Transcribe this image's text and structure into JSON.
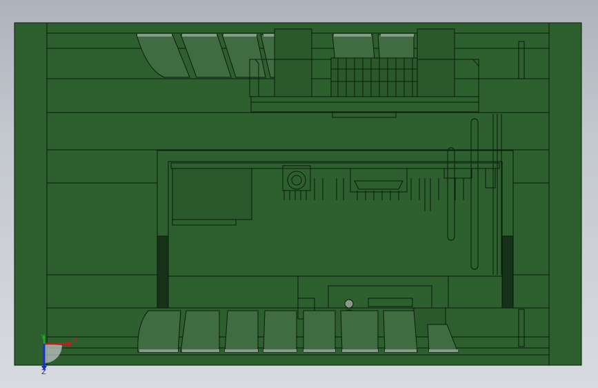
{
  "view": {
    "background_top": "#aeb3bb",
    "background_bottom": "#d8dbe0",
    "model_fill": "#2d5f2f",
    "model_fill_dark": "#214a23",
    "shadow_fill": "#153318",
    "edge_color": "#0c1a0c",
    "highlight_fill": "#5a7a5a"
  },
  "triad": {
    "x_label": "X",
    "y_label": "Y",
    "z_label": "Z",
    "x_color": "#d01818",
    "y_color": "#18b018",
    "z_color": "#1830d0"
  }
}
